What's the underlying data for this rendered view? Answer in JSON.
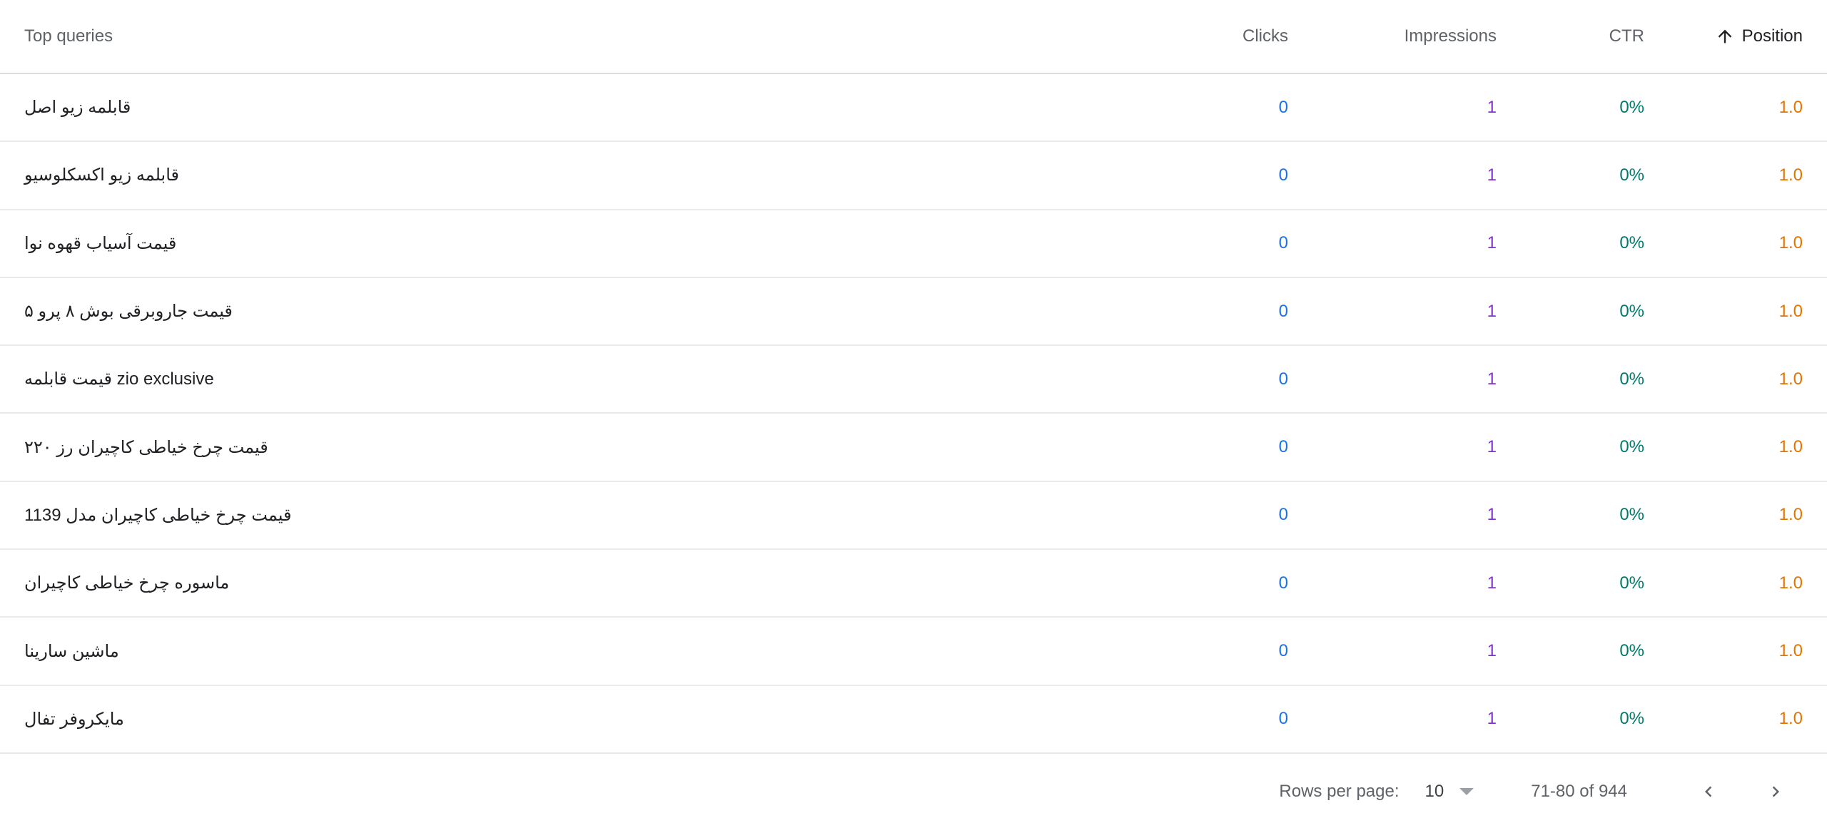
{
  "table": {
    "headers": {
      "query": "Top queries",
      "clicks": "Clicks",
      "impressions": "Impressions",
      "ctr": "CTR",
      "position": "Position"
    },
    "sort_icon": "arrow-up-icon",
    "rows": [
      {
        "query": "قابلمه زیو اصل",
        "clicks": "0",
        "impressions": "1",
        "ctr": "0%",
        "position": "1.0"
      },
      {
        "query": "قابلمه زیو اکسکلوسیو",
        "clicks": "0",
        "impressions": "1",
        "ctr": "0%",
        "position": "1.0"
      },
      {
        "query": "قیمت آسیاب قهوه نوا",
        "clicks": "0",
        "impressions": "1",
        "ctr": "0%",
        "position": "1.0"
      },
      {
        "query": "قیمت جاروبرقی بوش ۸ پرو ۵",
        "clicks": "0",
        "impressions": "1",
        "ctr": "0%",
        "position": "1.0"
      },
      {
        "query": "قیمت قابلمه zio exclusive",
        "clicks": "0",
        "impressions": "1",
        "ctr": "0%",
        "position": "1.0"
      },
      {
        "query": "قیمت چرخ خیاطی کاچیران رز ۲۲۰",
        "clicks": "0",
        "impressions": "1",
        "ctr": "0%",
        "position": "1.0"
      },
      {
        "query": "قیمت چرخ خیاطی کاچیران مدل 1139",
        "clicks": "0",
        "impressions": "1",
        "ctr": "0%",
        "position": "1.0"
      },
      {
        "query": "ماسوره چرخ خیاطی کاچیران",
        "clicks": "0",
        "impressions": "1",
        "ctr": "0%",
        "position": "1.0"
      },
      {
        "query": "ماشین سارینا",
        "clicks": "0",
        "impressions": "1",
        "ctr": "0%",
        "position": "1.0"
      },
      {
        "query": "مایکروفر تفال",
        "clicks": "0",
        "impressions": "1",
        "ctr": "0%",
        "position": "1.0"
      }
    ]
  },
  "footer": {
    "rows_per_page_label": "Rows per page:",
    "rows_per_page_value": "10",
    "range_text": "71-80 of 944",
    "prev_icon": "chevron-left-icon",
    "next_icon": "chevron-right-icon"
  },
  "colors": {
    "clicks": "#1a73e8",
    "impressions": "#8430ce",
    "ctr": "#00796b",
    "position": "#e37400"
  }
}
